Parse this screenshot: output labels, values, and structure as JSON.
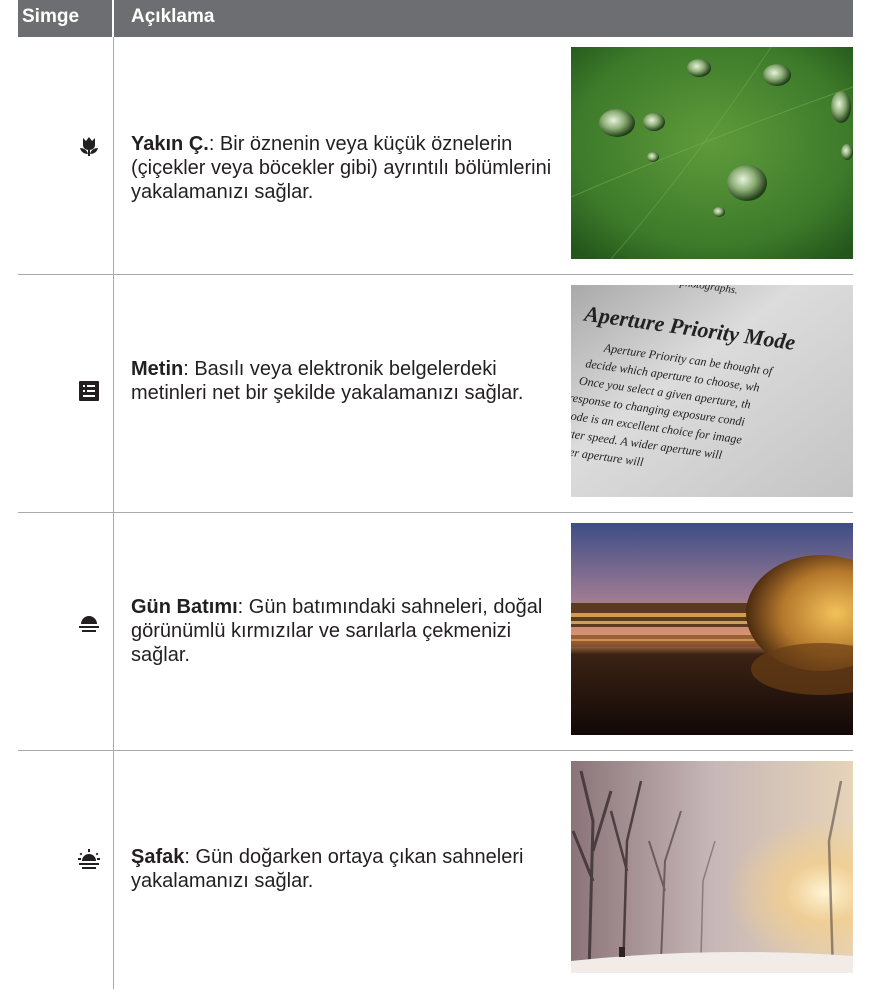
{
  "header": {
    "col_icon": "Simge",
    "col_desc": "Açıklama"
  },
  "rows": [
    {
      "icon": "macro-flower-icon",
      "title": "Yakın Ç.",
      "text": ": Bir öznenin veya küçük öznelerin (çiçekler veya böcekler gibi) ayrıntılı bölümlerini yakalamanızı sağlar.",
      "photo": "water-droplets-on-leaf-photo"
    },
    {
      "icon": "text-document-icon",
      "title": "Metin",
      "text": ": Basılı veya elektronik belgelerdeki metinleri net bir şekilde yakalamanızı sağlar.",
      "photo": "printed-page-photo",
      "photo_text": {
        "line0": "of your photographs.",
        "heading": "Aperture Priority Mode",
        "lines": [
          "Aperture Priority can be thought of",
          "decide which aperture to choose, wh",
          "Once you select a given aperture, th",
          "response to changing exposure condi",
          "mode is an excellent choice for image",
          "shutter speed. A wider aperture will",
          "smaller aperture will"
        ]
      }
    },
    {
      "icon": "sunset-icon",
      "title": "Gün Batımı",
      "text": ": Gün batımındaki sahneleri, doğal görünümlü kırmızılar ve sarılarla çekmenizi sağlar.",
      "photo": "sunset-building-reflection-photo"
    },
    {
      "icon": "dawn-icon",
      "title": "Şafak",
      "text": ": Gün doğarken ortaya çıkan sahneleri yakalamanızı sağlar.",
      "photo": "foggy-dawn-trees-photo"
    }
  ],
  "colors": {
    "header_bg": "#6d6e71",
    "rule": "#a7a9ac",
    "text": "#231f20"
  }
}
